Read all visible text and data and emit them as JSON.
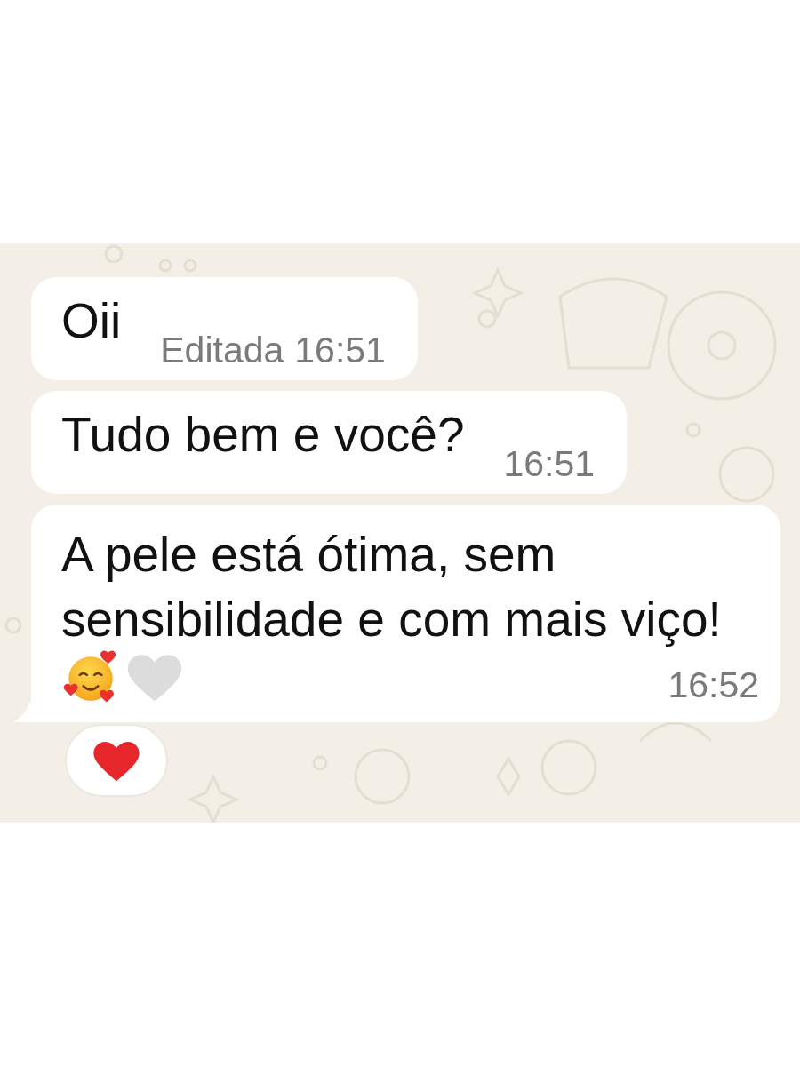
{
  "messages": [
    {
      "text": "Oii",
      "edited_label": "Editada",
      "time": "16:51",
      "has_emoji": false,
      "tail": false
    },
    {
      "text": "Tudo bem e você?",
      "time": "16:51",
      "has_emoji": false,
      "tail": false
    },
    {
      "text": "A pele está ótima, sem sensibilidade e com mais viço!",
      "time": "16:52",
      "has_emoji": true,
      "tail": true,
      "reaction": {
        "kind": "heart"
      }
    }
  ]
}
